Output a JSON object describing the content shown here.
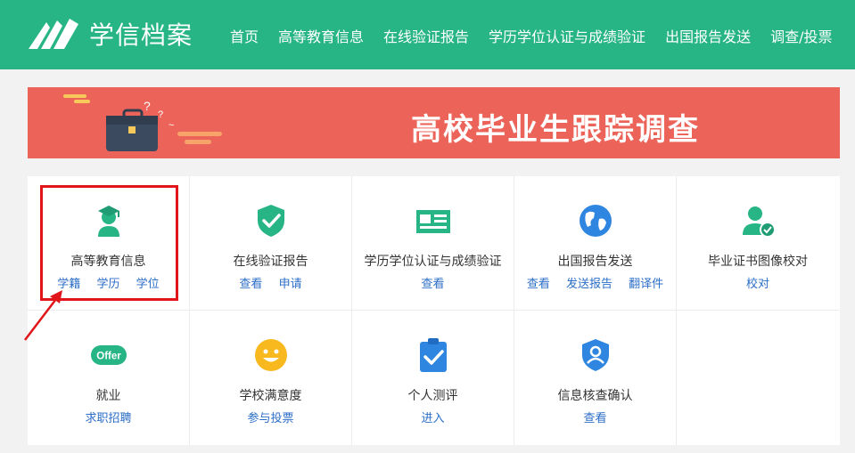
{
  "header": {
    "logo_text": "学信档案",
    "nav": [
      "首页",
      "高等教育信息",
      "在线验证报告",
      "学历学位认证与成绩验证",
      "出国报告发送",
      "调查/投票"
    ]
  },
  "banner": {
    "title": "高校毕业生跟踪调查"
  },
  "services": [
    {
      "title": "高等教育信息",
      "icon": "graduate-icon",
      "links": [
        "学籍",
        "学历",
        "学位"
      ]
    },
    {
      "title": "在线验证报告",
      "icon": "shield-check-icon",
      "links": [
        "查看",
        "申请"
      ]
    },
    {
      "title": "学历学位认证与成绩验证",
      "icon": "id-card-icon",
      "links": [
        "查看"
      ]
    },
    {
      "title": "出国报告发送",
      "icon": "globe-icon",
      "links": [
        "查看",
        "发送报告",
        "翻译件"
      ]
    },
    {
      "title": "毕业证书图像校对",
      "icon": "user-check-icon",
      "links": [
        "校对"
      ]
    },
    {
      "title": "就业",
      "icon": "offer-icon",
      "links": [
        "求职招聘"
      ]
    },
    {
      "title": "学校满意度",
      "icon": "smiley-icon",
      "links": [
        "参与投票"
      ]
    },
    {
      "title": "个人测评",
      "icon": "clipboard-check-icon",
      "links": [
        "进入"
      ]
    },
    {
      "title": "信息核查确认",
      "icon": "shield-user-icon",
      "links": [
        "查看"
      ]
    }
  ],
  "offer_icon_text": "Offer",
  "colors": {
    "header": "#27b586",
    "banner": "#ec6459",
    "link": "#2b6ec7",
    "highlight": "#e0161a"
  }
}
